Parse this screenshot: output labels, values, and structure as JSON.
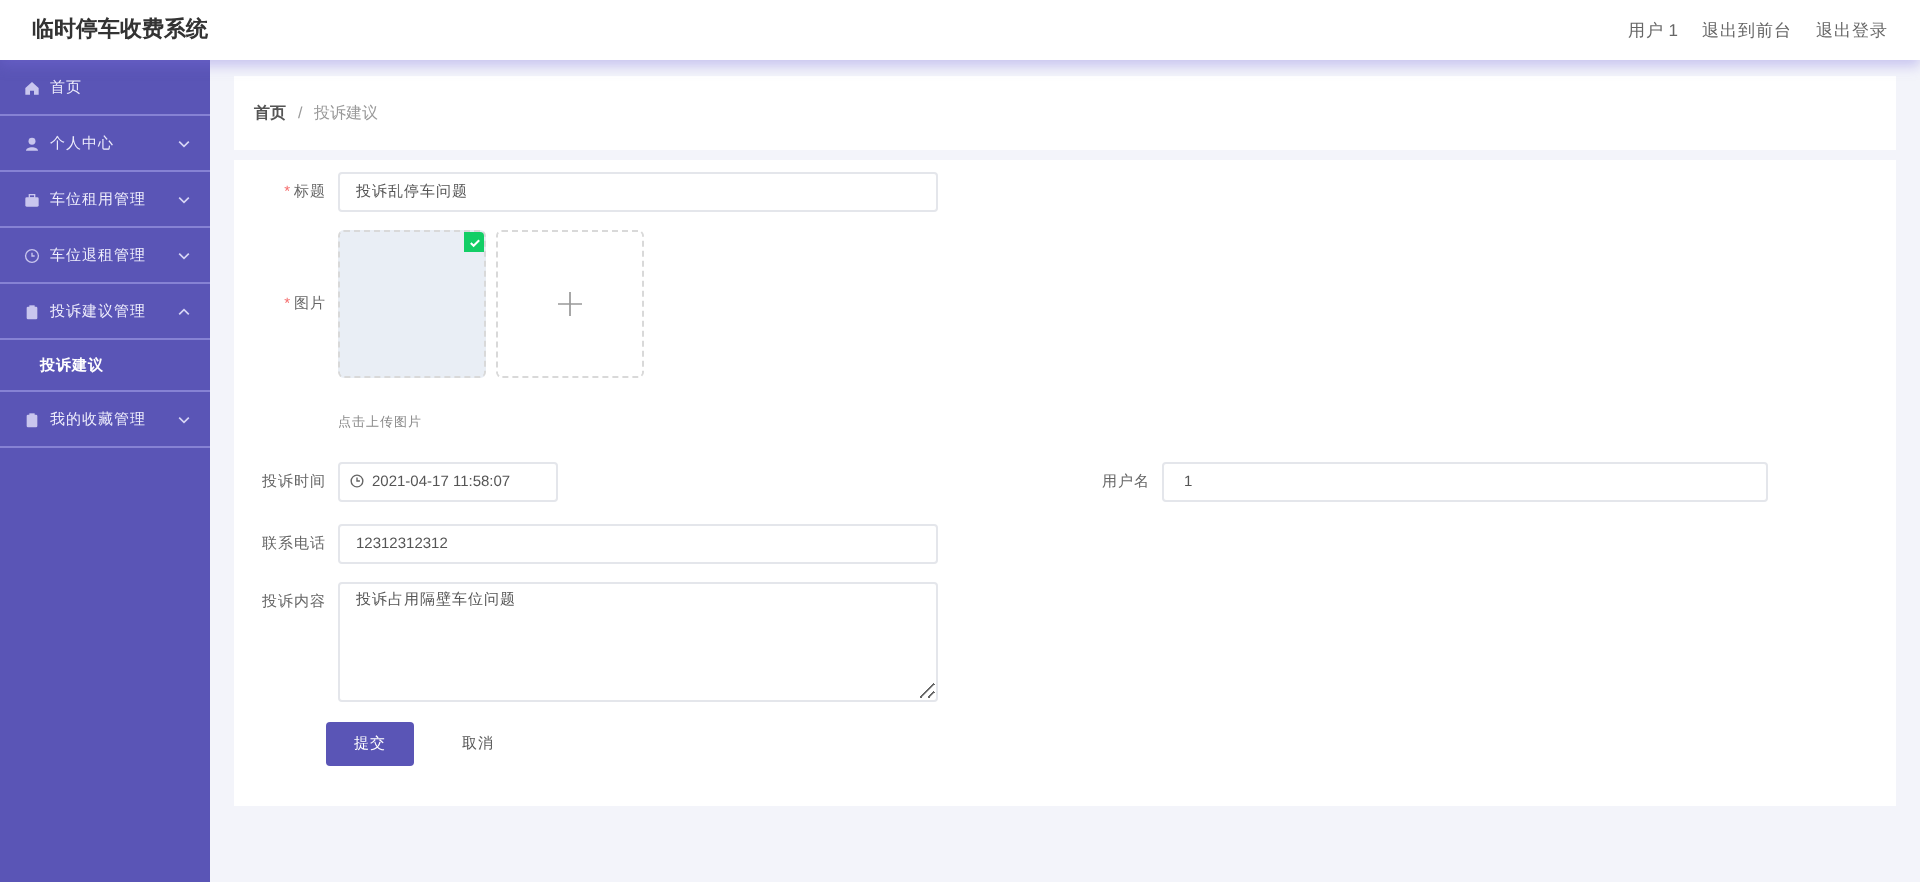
{
  "header": {
    "title": "临时停车收费系统",
    "links": [
      "用户 1",
      "退出到前台",
      "退出登录"
    ]
  },
  "sidebar": {
    "items": [
      {
        "label": "首页"
      },
      {
        "label": "个人中心",
        "expanded": false
      },
      {
        "label": "车位租用管理",
        "expanded": false
      },
      {
        "label": "车位退租管理",
        "expanded": false
      },
      {
        "label": "投诉建议管理",
        "expanded": true,
        "children": [
          {
            "label": "投诉建议",
            "selected": true
          }
        ]
      },
      {
        "label": "我的收藏管理",
        "expanded": false
      }
    ]
  },
  "breadcrumb": {
    "items": [
      "首页",
      "投诉建议"
    ],
    "separator": "/"
  },
  "form": {
    "fields": [
      {
        "kind": "text",
        "label": "标题",
        "required_mark": "*",
        "value": "投诉乱停车问题"
      },
      {
        "kind": "upload",
        "label": "图片",
        "required_mark": "*",
        "uploaded": true,
        "hint": "点击上传图片"
      },
      {
        "kind": "datetime",
        "label": "投诉时间",
        "value": "2021-04-17 11:58:07",
        "side_label": "用户名",
        "side_value": "1"
      },
      {
        "kind": "text",
        "label": "联系电话",
        "value": "12312312312"
      },
      {
        "kind": "textarea",
        "label": "投诉内容",
        "value": "投诉占用隔壁车位问题"
      }
    ],
    "buttons": [
      {
        "label": "提交",
        "kind": "primary"
      },
      {
        "label": "取消",
        "kind": "plain"
      }
    ]
  }
}
